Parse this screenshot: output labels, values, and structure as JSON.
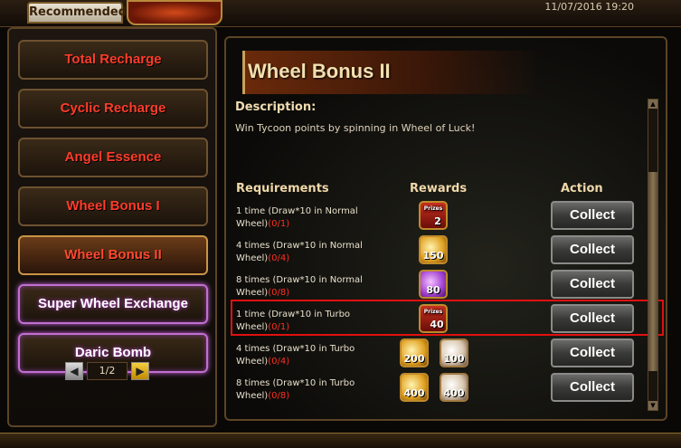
{
  "header": {
    "tab_label": "Recommended",
    "datetime": "11/07/2016 19:20"
  },
  "sidebar": {
    "items": [
      {
        "label": "Total Recharge"
      },
      {
        "label": "Cyclic Recharge"
      },
      {
        "label": "Angel Essence"
      },
      {
        "label": "Wheel Bonus I"
      },
      {
        "label": "Wheel Bonus II",
        "active": true
      },
      {
        "label": "Super Wheel Exchange"
      },
      {
        "label": "Daric Bomb"
      }
    ],
    "pager": {
      "text": "1/2",
      "prev": "◀",
      "next": "▶"
    }
  },
  "main": {
    "title": "Wheel Bonus II",
    "description_label": "Description:",
    "description_text": "Win Tycoon points by spinning in Wheel of Luck!",
    "columns": {
      "requirements": "Requirements",
      "rewards": "Rewards",
      "action": "Action"
    },
    "rows": [
      {
        "req_line1": "1 time (Draw*10 in Normal",
        "req_line2": "Wheel)",
        "progress": "(0/1)",
        "rewards": [
          {
            "type": "prize-box",
            "tag": "Prizes",
            "count": "2"
          }
        ],
        "action": "Collect"
      },
      {
        "req_line1": "4 times (Draw*10 in Normal",
        "req_line2": "Wheel)",
        "progress": "(0/4)",
        "rewards": [
          {
            "type": "gold-coin",
            "count": "150"
          }
        ],
        "action": "Collect"
      },
      {
        "req_line1": "8 times (Draw*10 in Normal",
        "req_line2": "Wheel)",
        "progress": "(0/8)",
        "rewards": [
          {
            "type": "purple-gem",
            "count": "80"
          }
        ],
        "action": "Collect"
      },
      {
        "req_line1": "1 time (Draw*10 in Turbo",
        "req_line2": "Wheel)",
        "progress": "(0/1)",
        "rewards": [
          {
            "type": "prize-box",
            "tag": "Prizes",
            "count": "40"
          }
        ],
        "action": "Collect"
      },
      {
        "req_line1": "4 times (Draw*10 in Turbo",
        "req_line2": "Wheel)",
        "progress": "(0/4)",
        "rewards": [
          {
            "type": "gold-coin",
            "count": "200"
          },
          {
            "type": "pearl",
            "count": "100"
          }
        ],
        "action": "Collect"
      },
      {
        "req_line1": "8 times (Draw*10 in Turbo",
        "req_line2": "Wheel)",
        "progress": "(0/8)",
        "rewards": [
          {
            "type": "gold-coin",
            "count": "400"
          },
          {
            "type": "pearl",
            "count": "400"
          }
        ],
        "action": "Collect"
      }
    ]
  },
  "colors": {
    "requirement_progress": "#ff3020",
    "nav_text": "#ff3c2a",
    "highlight_border": "#e01010"
  }
}
